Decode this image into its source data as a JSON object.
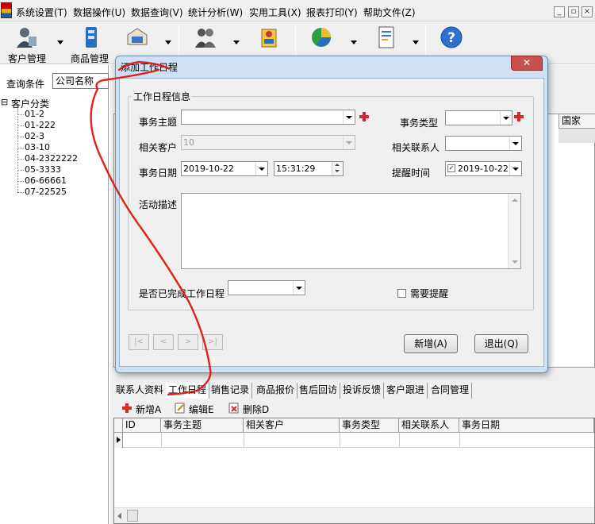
{
  "menubar": {
    "items": [
      "系统设置(T)",
      "数据操作(U)",
      "数据查询(V)",
      "统计分析(W)",
      "实用工具(X)",
      "报表打印(Y)",
      "帮助文件(Z)"
    ],
    "window_buttons": [
      "_",
      "▫",
      "×"
    ]
  },
  "toolbar": {
    "items": [
      {
        "label": "客户管理",
        "icon": "customer-icon"
      },
      {
        "label": "商品管理",
        "icon": "product-icon"
      },
      {
        "label": "销售管理",
        "icon": "sales-icon"
      },
      {
        "label": "业务员",
        "icon": "staff-icon"
      },
      {
        "label": "工作日程",
        "icon": "schedule-icon"
      },
      {
        "label": "统计分析",
        "icon": "chart-icon"
      },
      {
        "label": "报表打印",
        "icon": "report-icon"
      },
      {
        "label": "帮助文件",
        "icon": "help-icon"
      }
    ]
  },
  "left": {
    "query_label": "查询条件",
    "query_value": "公司名称",
    "tree_root_toggle": "⊟",
    "tree_root": "客户分类",
    "tree_items": [
      "01-2",
      "01-222",
      "02-3",
      "03-10",
      "04-2322222",
      "05-3333",
      "06-66661",
      "07-22525"
    ]
  },
  "background": {
    "column_header": "国家",
    "tabs": [
      "联系人资料",
      "工作日程",
      "销售记录",
      "商品报价",
      "售后回访",
      "投诉反馈",
      "客户跟进",
      "合同管理"
    ],
    "actions": [
      "新增A",
      "编辑E",
      "删除D"
    ],
    "grid_columns": [
      "ID",
      "事务主题",
      "相关客户",
      "事务类型",
      "相关联系人",
      "事务日期"
    ]
  },
  "dialog": {
    "title": "添加工作日程",
    "close": "✕",
    "group_title": "工作日程信息",
    "subject_label": "事务主题",
    "subject_value": "",
    "type_label": "事务类型",
    "type_value": "",
    "customer_label": "相关客户",
    "customer_value": "10",
    "contact_label": "相关联系人",
    "contact_value": "",
    "date_label": "事务日期",
    "date_value": "2019-10-22",
    "time_value": "15:31:29",
    "remind_label": "提醒时间",
    "remind_value": "2019-10-22",
    "remind_checkbox": "✓",
    "desc_label": "活动描述",
    "desc_value": "",
    "completed_label": "是否已完成工作日程",
    "completed_value": "",
    "need_remind_label": "需要提醒",
    "nav_buttons": [
      "|<",
      "<",
      ">",
      ">|"
    ],
    "add_button": "新增(A)",
    "exit_button": "退出(Q)"
  },
  "colors": {
    "annotation": "#e0201c",
    "dialog_frame": "#cfe0f2",
    "close_button": "#c75050",
    "plus": "#d9262c"
  }
}
